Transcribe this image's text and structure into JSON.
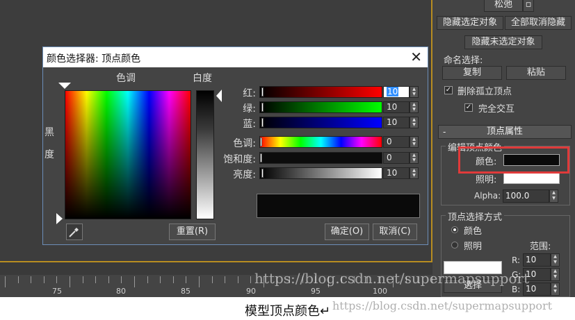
{
  "dialog": {
    "title": "颜色选择器: 顶点颜色",
    "close_glyph": "✕",
    "hue_label": "色调",
    "whiteness_label": "白度",
    "blackness_label_1": "黑",
    "blackness_label_2": "度",
    "channels": [
      {
        "label": "红:",
        "value": "10"
      },
      {
        "label": "绿:",
        "value": "10"
      },
      {
        "label": "蓝:",
        "value": "10"
      },
      {
        "label": "色调:",
        "value": "0"
      },
      {
        "label": "饱和度:",
        "value": "0"
      },
      {
        "label": "亮度:",
        "value": "10"
      }
    ],
    "reset_label": "重置(R)",
    "ok_label": "确定(O)",
    "cancel_label": "取消(C)",
    "preview_color": "#0a0a0a"
  },
  "panel": {
    "loosen_label": "松弛",
    "hide_selected_label": "隐藏选定对象",
    "unhide_all_label": "全部取消隐藏",
    "hide_unselected_label": "隐藏未选定对象",
    "named_selection_label": "命名选择:",
    "copy_label": "复制",
    "paste_label": "粘贴",
    "delete_isolated_label": "删除孤立顶点",
    "full_interaction_label": "完全交互",
    "rollout_title": "顶点属性",
    "rollout_sign": "-",
    "edit_vertex_color_label": "编辑顶点颜色",
    "color_label": "颜色:",
    "illumination_label": "照明:",
    "alpha_label": "Alpha:",
    "alpha_value": "100.0",
    "select_by_label": "顶点选择方式",
    "radio_color_label": "颜色",
    "radio_illum_label": "照明",
    "range_label": "范围:",
    "r_label": "R:",
    "g_label": "G:",
    "b_label": "B:",
    "r_value": "10",
    "g_value": "10",
    "b_value": "10",
    "select_button_label": "选择"
  },
  "timeline": {
    "labels": [
      "75",
      "80",
      "85",
      "90",
      "95",
      "100"
    ]
  },
  "watermark_1": "https://blog.csdn.net/supermapsupport",
  "watermark_2": "https://blog.csdn.net/supermapsupport",
  "caption": "模型顶点颜色↵",
  "colors": {
    "viewport_bg": "#3d3d3d",
    "viewport_border": "#b88d20",
    "highlight": "#e03a3a",
    "selected_value_bg": "#3390ff"
  }
}
